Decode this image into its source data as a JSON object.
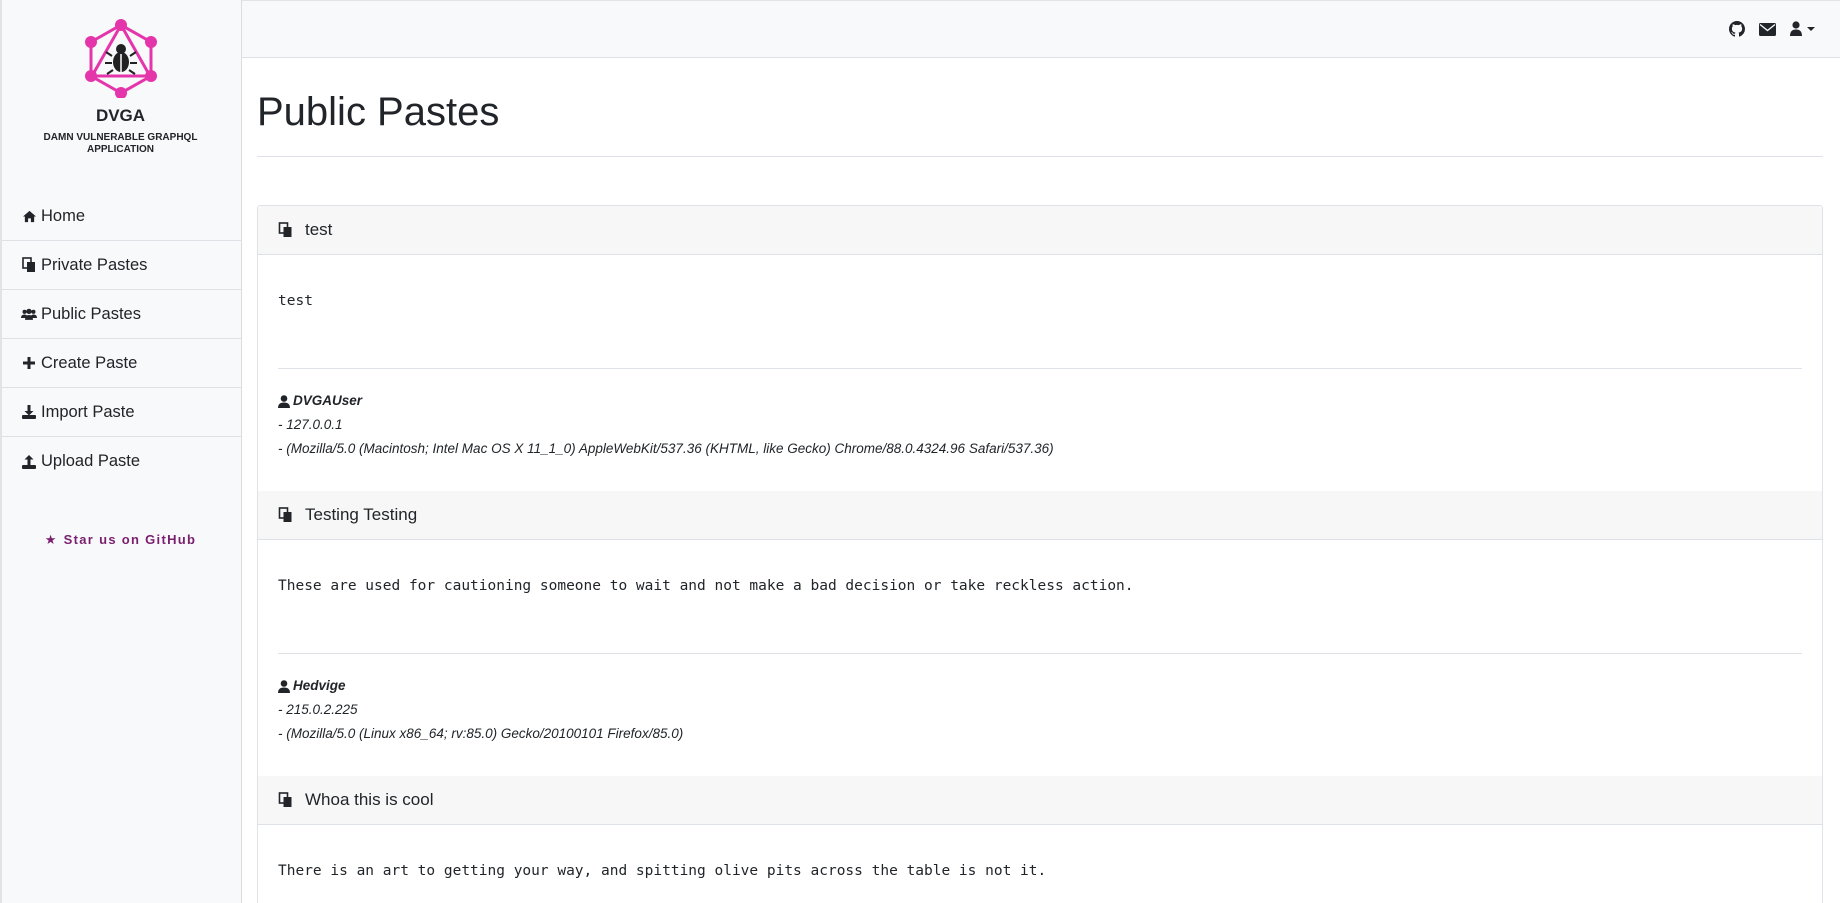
{
  "app": {
    "name": "DVGA",
    "subtitle_line1": "DAMN VULNERABLE GRAPHQL",
    "subtitle_line2": "APPLICATION"
  },
  "colors": {
    "brand_pink": "#e535ab",
    "star_link": "#7a1f6e",
    "sidebar_bg": "#f8f9fa"
  },
  "sidebar": {
    "items": [
      {
        "label": "Home",
        "icon": "home-icon"
      },
      {
        "label": "Private Pastes",
        "icon": "copy-icon"
      },
      {
        "label": "Public Pastes",
        "icon": "users-icon"
      },
      {
        "label": "Create Paste",
        "icon": "plus-icon"
      },
      {
        "label": "Import Paste",
        "icon": "download-icon"
      },
      {
        "label": "Upload Paste",
        "icon": "upload-icon"
      }
    ],
    "star_label": "Star us on GitHub"
  },
  "topbar": {
    "icons": [
      "github-icon",
      "envelope-icon",
      "user-dropdown-icon"
    ]
  },
  "page": {
    "title": "Public Pastes"
  },
  "pastes": [
    {
      "title": "test",
      "content": "test",
      "owner": "DVGAUser",
      "ip": "- 127.0.0.1",
      "user_agent": "- (Mozilla/5.0 (Macintosh; Intel Mac OS X 11_1_0) AppleWebKit/537.36 (KHTML, like Gecko) Chrome/88.0.4324.96 Safari/537.36)"
    },
    {
      "title": "Testing Testing",
      "content": "These are used for cautioning someone to wait and not make a bad decision or take reckless action.",
      "owner": "Hedvige",
      "ip": "- 215.0.2.225",
      "user_agent": "- (Mozilla/5.0 (Linux x86_64; rv:85.0) Gecko/20100101 Firefox/85.0)"
    },
    {
      "title": "Whoa this is cool",
      "content": "There is an art to getting your way, and spitting olive pits across the table is not it."
    }
  ]
}
